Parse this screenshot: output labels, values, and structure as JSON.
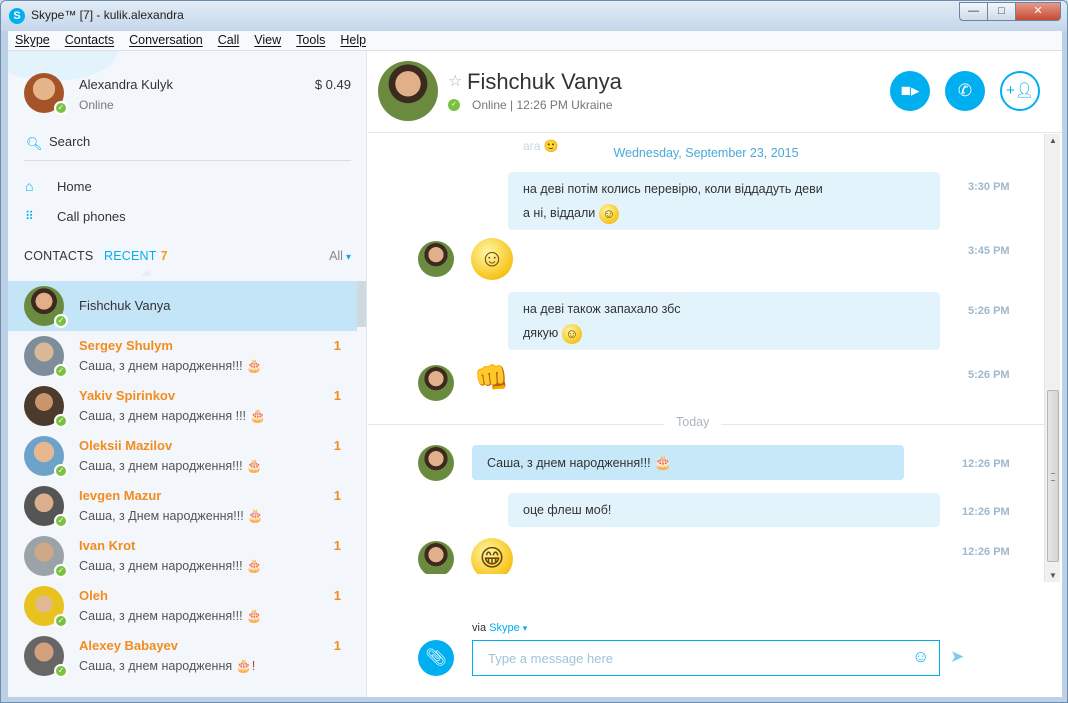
{
  "window": {
    "title": "Skype™ [7] - kulik.alexandra",
    "controls": {
      "minimize": "—",
      "maximize": "□",
      "close": "✕"
    }
  },
  "menu": [
    "Skype",
    "Contacts",
    "Conversation",
    "Call",
    "View",
    "Tools",
    "Help"
  ],
  "me": {
    "name": "Alexandra Kulyk",
    "status": "Online",
    "credit": "$ 0.49"
  },
  "search": {
    "label": "Search"
  },
  "nav": [
    {
      "label": "Home",
      "icon": "home-icon"
    },
    {
      "label": "Call phones",
      "icon": "dialpad-icon"
    }
  ],
  "tabs": {
    "contacts": "CONTACTS",
    "recent": "RECENT",
    "recent_count": "7",
    "filter": "All"
  },
  "contacts": [
    {
      "name": "Fishchuk Vanya",
      "message": "",
      "badge": "",
      "cake": "",
      "selected": true
    },
    {
      "name": "Sergey Shulym",
      "message": "Саша, з днем народження!!!",
      "cake": "🎂",
      "badge": "1"
    },
    {
      "name": "Yakiv Spirinkov",
      "message": "Саша, з днем народження !!!",
      "cake": "🎂",
      "badge": "1"
    },
    {
      "name": "Oleksii Mazilov",
      "message": "Саша, з днем народження!!!",
      "cake": "🎂",
      "badge": "1"
    },
    {
      "name": "Ievgen Mazur",
      "message": "Саша, з Днем народження!!!",
      "cake": "🎂",
      "badge": "1"
    },
    {
      "name": "Ivan Krot",
      "message": "Саша, з днем народження!!!",
      "cake": "🎂",
      "badge": "1"
    },
    {
      "name": "Oleh",
      "message": "Саша, з днем народження!!!",
      "cake": "🎂",
      "badge": "1"
    },
    {
      "name": "Alexey Babayev",
      "message": "Саша, з днем народження",
      "cake": "🎂!",
      "badge": "1"
    }
  ],
  "chat": {
    "name": "Fishchuk Vanya",
    "status": "Online  |  12:26 PM Ukraine",
    "buttons": {
      "video": "video-call-icon",
      "call": "phone-icon",
      "add": "add-contact-icon"
    },
    "faded_text": "ага 🙂",
    "date1": "Wednesday, September 23, 2015",
    "messages": [
      {
        "lines": [
          "на деві потім колись перевірю, коли віддадуть деви",
          "а ні, віддали"
        ],
        "time": "3:30 PM"
      },
      {
        "emoji": "smile",
        "time": "3:45 PM"
      },
      {
        "lines": [
          "на деві також запахало збс",
          "дякую"
        ],
        "time": "5:26 PM"
      },
      {
        "emoji": "fist",
        "time": "5:26 PM"
      },
      {
        "lines": [
          "Саша, з днем народження!!!"
        ],
        "time": "12:26 PM"
      },
      {
        "lines": [
          "оце флеш моб!"
        ],
        "time": "12:26 PM"
      },
      {
        "emoji": "grin",
        "time": "12:26 PM"
      }
    ],
    "today": "Today",
    "emoji_glyphs": {
      "smile": "☺",
      "grin": "😁",
      "fist": "👊",
      "cake": "🎂"
    }
  },
  "compose": {
    "via": "via",
    "via_service": "Skype",
    "placeholder": "Type a message here"
  }
}
